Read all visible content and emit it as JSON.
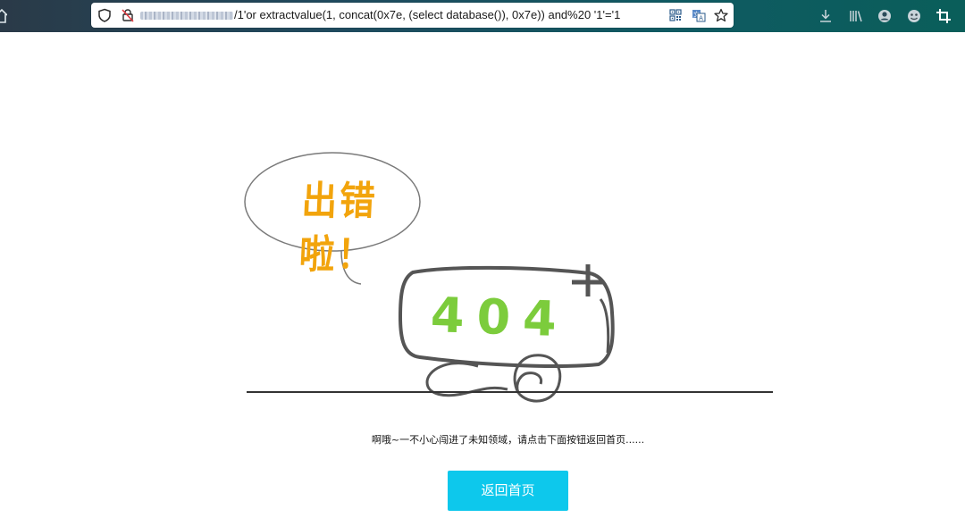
{
  "browser": {
    "url_visible": "/1'or extractvalue(1, concat(0x7e, (select database()), 0x7e)) and%20 '1'='1",
    "icons": [
      "home-icon",
      "shield-icon",
      "connection-not-secure-icon",
      "qr-code-icon",
      "translate-icon",
      "bookmark-star-icon",
      "download-icon",
      "library-icon",
      "account-icon",
      "extension-icon",
      "crop-icon"
    ]
  },
  "illustration": {
    "bubble_text": "出错啦！",
    "tv_text": "404"
  },
  "page": {
    "message": "啊哦~一不小心闯进了未知领域，请点击下面按钮返回首页......",
    "button_label": "返回首页"
  },
  "colors": {
    "toolbar_start": "#2a3a48",
    "toolbar_end": "#0a5e5a",
    "bubble_text": "#f2a40c",
    "tv_text": "#7ccc3c",
    "button": "#0dc8ec"
  }
}
